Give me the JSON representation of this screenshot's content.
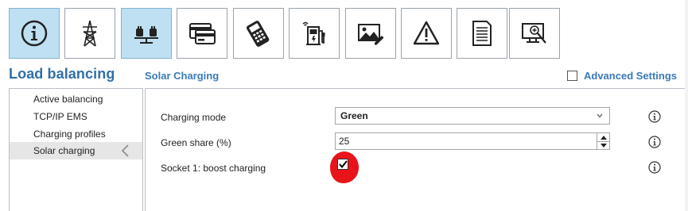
{
  "toolbar": {
    "buttons": [
      {
        "icon": "info-icon",
        "active": true
      },
      {
        "icon": "power-pylon-icon",
        "active": false
      },
      {
        "icon": "load-balance-icon",
        "active": true
      },
      {
        "icon": "card-reader-icon",
        "active": false
      },
      {
        "icon": "payment-terminal-icon",
        "active": false
      },
      {
        "icon": "charging-station-icon",
        "active": false
      },
      {
        "icon": "image-edit-icon",
        "active": false
      },
      {
        "icon": "warning-icon",
        "active": false
      },
      {
        "icon": "document-icon",
        "active": false
      },
      {
        "icon": "diagnostics-icon",
        "active": false
      }
    ]
  },
  "header": {
    "section_title": "Load balancing",
    "page_title": "Solar Charging",
    "advanced_settings_label": "Advanced Settings",
    "advanced_settings_checked": false
  },
  "nav": {
    "items": [
      {
        "label": "Active balancing"
      },
      {
        "label": "TCP/IP EMS"
      },
      {
        "label": "Charging profiles"
      },
      {
        "label": "Solar charging",
        "selected": true
      }
    ]
  },
  "form": {
    "charging_mode_label": "Charging mode",
    "charging_mode_value": "Green",
    "green_share_label": "Green share (%)",
    "green_share_value": "25",
    "boost_label": "Socket 1: boost charging",
    "boost_checked": true
  },
  "colors": {
    "accent": "#2f6fa8",
    "active_button": "#bfe0f2",
    "annotation": "#e8141a"
  }
}
